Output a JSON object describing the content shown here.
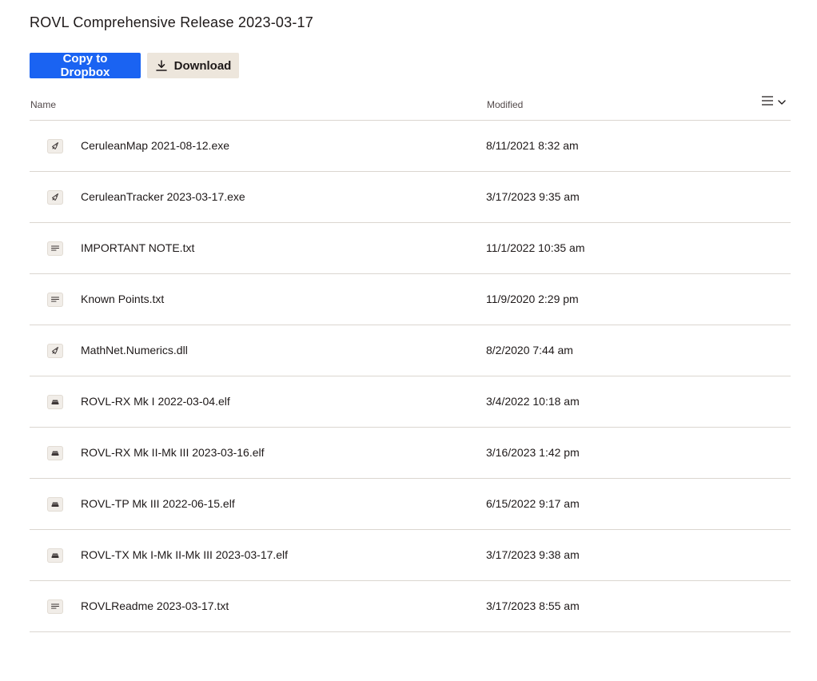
{
  "header": {
    "title": "ROVL Comprehensive Release 2023-03-17"
  },
  "toolbar": {
    "copy_label": "Copy to Dropbox",
    "download_label": "Download",
    "download_icon": "download-icon"
  },
  "table": {
    "columns": {
      "name": "Name",
      "modified": "Modified"
    },
    "view_toggle_icon": "list-view-icon",
    "rows": [
      {
        "name": "CeruleanMap 2021-08-12.exe",
        "modified": "8/11/2021 8:32 am",
        "icon": "executable-icon"
      },
      {
        "name": "CeruleanTracker 2023-03-17.exe",
        "modified": "3/17/2023 9:35 am",
        "icon": "executable-icon"
      },
      {
        "name": "IMPORTANT NOTE.txt",
        "modified": "11/1/2022 10:35 am",
        "icon": "text-file-icon"
      },
      {
        "name": "Known Points.txt",
        "modified": "11/9/2020 2:29 pm",
        "icon": "text-file-icon"
      },
      {
        "name": "MathNet.Numerics.dll",
        "modified": "8/2/2020 7:44 am",
        "icon": "executable-icon"
      },
      {
        "name": "ROVL-RX Mk I 2022-03-04.elf",
        "modified": "3/4/2022 10:18 am",
        "icon": "binary-file-icon"
      },
      {
        "name": "ROVL-RX Mk II-Mk III 2023-03-16.elf",
        "modified": "3/16/2023 1:42 pm",
        "icon": "binary-file-icon"
      },
      {
        "name": "ROVL-TP Mk III 2022-06-15.elf",
        "modified": "6/15/2022 9:17 am",
        "icon": "binary-file-icon"
      },
      {
        "name": "ROVL-TX Mk I-Mk II-Mk III 2023-03-17.elf",
        "modified": "3/17/2023 9:38 am",
        "icon": "binary-file-icon"
      },
      {
        "name": "ROVLReadme 2023-03-17.txt",
        "modified": "3/17/2023 8:55 am",
        "icon": "text-file-icon"
      }
    ]
  },
  "colors": {
    "primary": "#1a63f2",
    "secondary_button": "#ede6dc",
    "divider": "#dbd6d0",
    "text": "#1e1919"
  }
}
